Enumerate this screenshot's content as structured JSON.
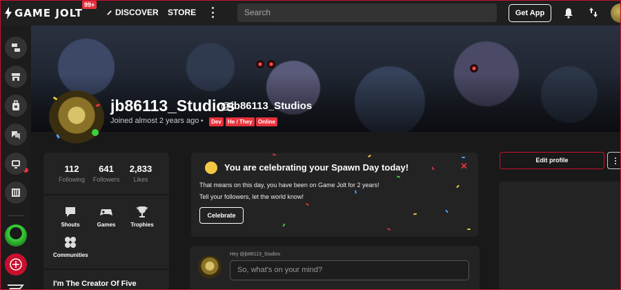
{
  "topnav": {
    "logo_text": "GAME JOLT",
    "notification_count": "99+",
    "discover_label": "DISCOVER",
    "store_label": "STORE",
    "search_placeholder": "Search",
    "get_app_label": "Get App"
  },
  "sidebar": {
    "items": [
      {
        "icon": "discover-icon"
      },
      {
        "icon": "store-icon"
      },
      {
        "icon": "backpack-icon"
      },
      {
        "icon": "chat-icon"
      },
      {
        "icon": "devlog-icon"
      },
      {
        "icon": "library-icon"
      }
    ]
  },
  "profile": {
    "display_name": "jb86113_Studios",
    "handle": "@jb86113_Studios",
    "joined": "Joined almost 2 years ago",
    "tags": [
      "Dev",
      "He / They",
      "Online"
    ],
    "stats": [
      {
        "value": "112",
        "label": "Following"
      },
      {
        "value": "641",
        "label": "Followers"
      },
      {
        "value": "2,833",
        "label": "Likes"
      }
    ],
    "links": [
      {
        "label": "Shouts",
        "icon": "shouts-icon"
      },
      {
        "label": "Games",
        "icon": "gamepad-icon"
      },
      {
        "label": "Trophies",
        "icon": "trophy-icon"
      },
      {
        "label": "Communities",
        "icon": "communities-icon"
      }
    ],
    "bio_preview": "I'm The Creator Of Five"
  },
  "spawn_day": {
    "title": "You are celebrating your Spawn Day today!",
    "line1": "That means on this day, you have been on Game Jolt for 2 years!",
    "line2": "Tell your followers, let the world know!",
    "celebrate_label": "Celebrate",
    "close_symbol": "✕"
  },
  "post": {
    "greeting": "Hey @jb86113_Studios",
    "placeholder": "So, what's on your mind?"
  },
  "right": {
    "edit_profile_label": "Edit profile"
  },
  "colors": {
    "accent": "#e8323c",
    "background": "#191919",
    "card": "#232323"
  }
}
